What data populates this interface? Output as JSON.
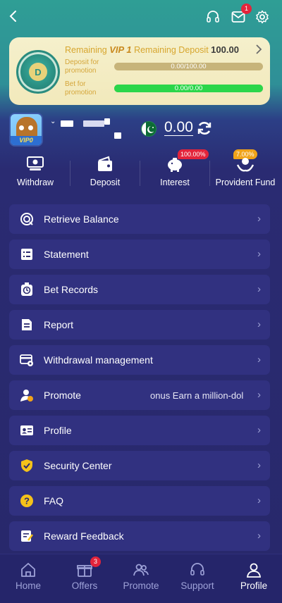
{
  "header": {
    "back_icon": "chevron-left-icon",
    "support_icon": "headset-icon",
    "mail_icon": "mail-icon",
    "mail_badge": "1",
    "settings_icon": "gear-icon"
  },
  "vip": {
    "label_prefix": "Remaining",
    "level": "VIP 1",
    "label_mid": "Remaining Deposit",
    "amount": "100.00",
    "rows": [
      {
        "label": "Deposit for promotion",
        "progress_text": "0.00/100.00",
        "fill": 0.0
      },
      {
        "label": "Bet for promotion",
        "progress_text": "0.00/0.00",
        "fill": 1.0
      }
    ]
  },
  "profile": {
    "avatar_badge": "VIP0",
    "balance": "0.00",
    "currency_flag": "pakistan-flag-icon"
  },
  "quick_actions": [
    {
      "label": "Withdraw",
      "icon": "withdraw-icon",
      "badge": ""
    },
    {
      "label": "Deposit",
      "icon": "wallet-icon",
      "badge": ""
    },
    {
      "label": "Interest",
      "icon": "piggy-bank-icon",
      "badge": "100.00%"
    },
    {
      "label": "Provident Fund",
      "icon": "hands-coin-icon",
      "badge": "7.00%"
    }
  ],
  "menu": [
    {
      "label": "Retrieve Balance",
      "icon": "target-icon",
      "extra": ""
    },
    {
      "label": "Statement",
      "icon": "document-list-icon",
      "extra": ""
    },
    {
      "label": "Bet Records",
      "icon": "stopwatch-icon",
      "extra": ""
    },
    {
      "label": "Report",
      "icon": "report-icon",
      "extra": ""
    },
    {
      "label": "Withdrawal management",
      "icon": "card-gear-icon",
      "extra": ""
    },
    {
      "label": "Promote",
      "icon": "user-promote-icon",
      "extra": "onus  Earn a million-dol"
    },
    {
      "label": "Profile",
      "icon": "id-card-icon",
      "extra": ""
    },
    {
      "label": "Security Center",
      "icon": "shield-check-icon",
      "extra": ""
    },
    {
      "label": "FAQ",
      "icon": "question-icon",
      "extra": ""
    },
    {
      "label": "Reward Feedback",
      "icon": "feedback-icon",
      "extra": ""
    }
  ],
  "nav": [
    {
      "label": "Home",
      "icon": "home-icon",
      "badge": ""
    },
    {
      "label": "Offers",
      "icon": "gift-icon",
      "badge": "3"
    },
    {
      "label": "Promote",
      "icon": "group-icon",
      "badge": ""
    },
    {
      "label": "Support",
      "icon": "headset-icon",
      "badge": ""
    },
    {
      "label": "Profile",
      "icon": "person-icon",
      "badge": ""
    }
  ],
  "colors": {
    "accent_green": "#2bd64a",
    "badge_red": "#e3243b",
    "menu_bg": "#313180",
    "gold_text": "#d7a62e"
  }
}
